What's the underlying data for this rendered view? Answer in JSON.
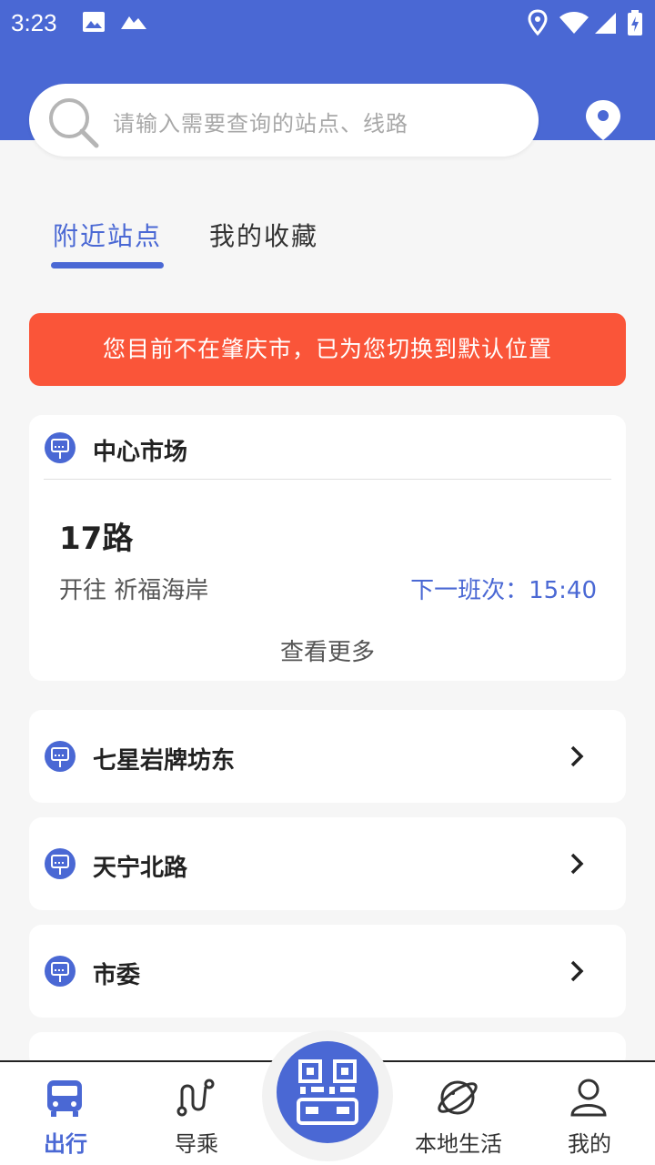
{
  "status_bar": {
    "time": "3:23"
  },
  "search": {
    "placeholder": "请输入需要查询的站点、线路"
  },
  "tabs": [
    {
      "label": "附近站点",
      "active": true
    },
    {
      "label": "我的收藏",
      "active": false
    }
  ],
  "alert": {
    "text": "您目前不在肇庆市，已为您切换到默认位置"
  },
  "nearest_stop": {
    "name": "中心市场",
    "route": "17路",
    "direction": "开往  祈福海岸",
    "next_bus": "下一班次：15:40",
    "more_label": "查看更多"
  },
  "stops": [
    {
      "name": "七星岩牌坊东"
    },
    {
      "name": "天宁北路"
    },
    {
      "name": "市委"
    }
  ],
  "bottom_nav": [
    {
      "label": "出行",
      "icon": "bus-icon",
      "active": true
    },
    {
      "label": "导乘",
      "icon": "route-icon",
      "active": false
    },
    {
      "label": "",
      "icon": "qr-code-icon",
      "active": false
    },
    {
      "label": "本地生活",
      "icon": "planet-icon",
      "active": false
    },
    {
      "label": "我的",
      "icon": "user-icon",
      "active": false
    }
  ],
  "colors": {
    "primary": "#4a68d4",
    "alert": "#fa5539",
    "background": "#f6f6f6"
  }
}
